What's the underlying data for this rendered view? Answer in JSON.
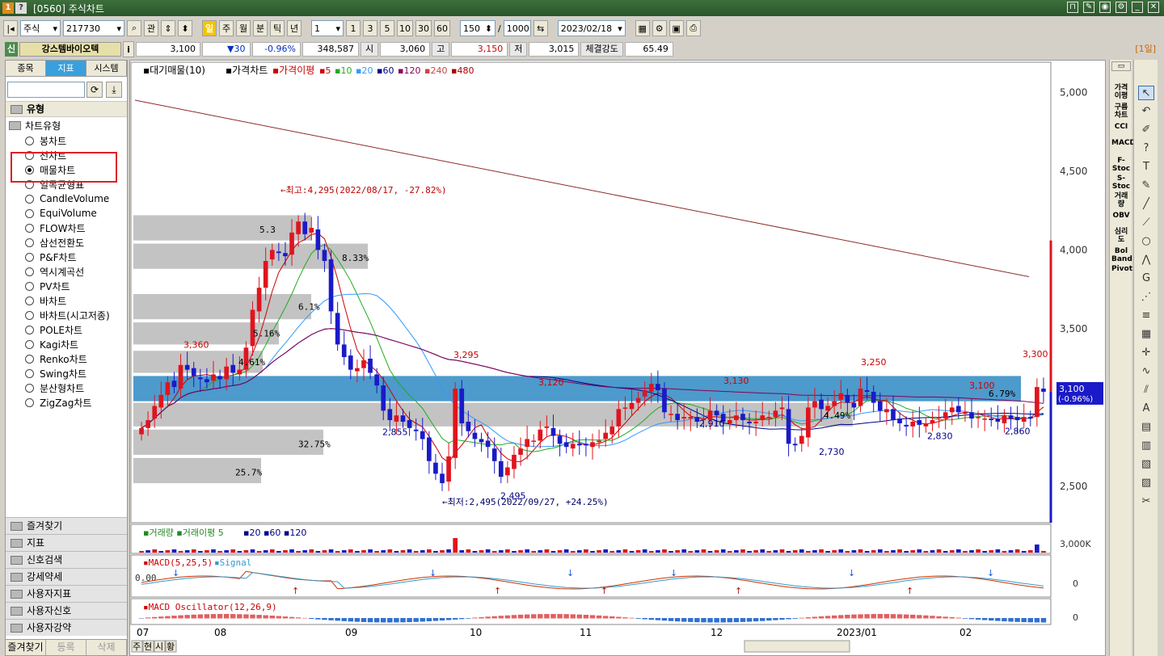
{
  "window": {
    "title": "[0560] 주식차트",
    "icon_names": [
      "app-icon",
      "help-icon"
    ],
    "controls": [
      "pin-icon",
      "note-icon",
      "camera-icon",
      "settings-icon",
      "minimize-icon",
      "close-icon"
    ]
  },
  "toolbar": {
    "market_select": "주식",
    "code": "217730",
    "mode_label": "관",
    "periods": [
      "일",
      "주",
      "월",
      "분",
      "틱",
      "년"
    ],
    "active_period": "일",
    "interval_value": "1",
    "quick_intervals": [
      "1",
      "3",
      "5",
      "10",
      "30",
      "60"
    ],
    "display_count": "150",
    "divider": "/",
    "total_count": "1000",
    "date": "2023/02/18"
  },
  "quote": {
    "tag": "신",
    "name": "강스템바이오텍",
    "info_icon": "i",
    "price": "3,100",
    "change": "▼30",
    "change_pct": "-0.96%",
    "volume": "348,587",
    "open_label": "시",
    "open": "3,060",
    "high_label": "고",
    "high": "3,150",
    "low_label": "저",
    "low": "3,015",
    "strength_label": "체결강도",
    "strength": "65.49",
    "period_badge": "[1일]"
  },
  "left_panel": {
    "tabs": [
      "종목",
      "지표",
      "시스템"
    ],
    "active_tab": "지표",
    "section_title": "유형",
    "tree_root": "차트유형",
    "chart_types": [
      "봉차트",
      "선차트",
      "매물차트",
      "일목균형표",
      "CandleVolume",
      "EquiVolume",
      "FLOW차트",
      "삼선전환도",
      "P&F차트",
      "역시계곡선",
      "PV차트",
      "바차트",
      "바차트(시고저종)",
      "POLE차트",
      "Kagi차트",
      "Renko차트",
      "Swing차트",
      "분산형차트",
      "ZigZag차트"
    ],
    "selected_type": "매물차트",
    "bottom_sections": [
      "즐겨찾기",
      "지표",
      "신호검색",
      "강세약세",
      "사용자지표",
      "사용자신호",
      "사용자강약"
    ],
    "footer": [
      "즐겨찾기",
      "등록",
      "삭제"
    ]
  },
  "chart": {
    "legend_main": {
      "vp": "대기매물(10)",
      "price": "가격차트",
      "ma": "가격이평",
      "periods": [
        "5",
        "10",
        "20",
        "60",
        "120",
        "240",
        "480"
      ],
      "colors": [
        "#cc0000",
        "#22aa22",
        "#3399ff",
        "#000088",
        "#880055",
        "#cc4444",
        "#aa0000"
      ]
    },
    "y_axis": [
      "5,000",
      "4,500",
      "4,000",
      "3,500",
      "2,500"
    ],
    "price_tag": "3,100",
    "price_tag_pct": "(-0.96%)",
    "annotations": {
      "high_note": "←최고:4,295(2022/08/17, -27.82%)",
      "low_note": "←최저:2,495(2022/09/27, +24.25%)",
      "peaks": [
        "3,360",
        "3,295",
        "3,120",
        "3,130",
        "3,250",
        "3,100",
        "3,300"
      ],
      "troughs": [
        "2,855",
        "2,495",
        "2,910",
        "2,730",
        "2,830",
        "2,860"
      ],
      "vp_pcts": [
        "5.3",
        "8.33%",
        "6.1%",
        "5.16%",
        "4.61%",
        "6.79%",
        "4.49%",
        "32.75%",
        "25.7%"
      ]
    },
    "volume_legend": {
      "vol": "거래량",
      "ma": "거래이평",
      "periods": [
        "5",
        "20",
        "60",
        "120"
      ]
    },
    "volume_axis": "3,000K",
    "macd_legend": {
      "macd": "MACD(5,25,5)",
      "signal": "Signal"
    },
    "macd_zero": "0.00",
    "macd_axis": "0",
    "osc_legend": "MACD Oscillator(12,26,9)",
    "osc_axis": "0",
    "x_labels": [
      "07",
      "08",
      "09",
      "10",
      "11",
      "12",
      "2023/01",
      "02"
    ],
    "bottom_tabs": [
      "주",
      "현",
      "시",
      "황"
    ]
  },
  "right_indicators": [
    "가격이평",
    "구름차트",
    "CCI",
    "MACD",
    "F-Stoc",
    "S-Stoc",
    "거래량",
    "OBV",
    "심리도",
    "Bol Band",
    "Pivot"
  ],
  "right_tools": [
    "cursor-icon",
    "undo-icon",
    "eraser-icon",
    "help-icon",
    "text-icon",
    "brush-icon",
    "line-icon",
    "ray-icon",
    "circle-icon",
    "zigzag-icon",
    "g-icon",
    "fan-icon",
    "fib-icon",
    "grid-icon",
    "cross-icon",
    "wave-icon",
    "channel-icon",
    "auto-icon",
    "window-icon",
    "doc-icon",
    "stats-icon",
    "code-icon",
    "wrench-icon"
  ],
  "chart_data": {
    "type": "candlestick",
    "title": "",
    "x_months": [
      "07",
      "08",
      "09",
      "10",
      "11",
      "12",
      "2023/01",
      "02"
    ],
    "ylim": [
      2300,
      5150
    ],
    "high": 4295,
    "low": 2495,
    "last": 3100,
    "closes": [
      2870,
      2920,
      3010,
      3080,
      3160,
      3130,
      3270,
      3240,
      3200,
      3180,
      3160,
      3210,
      3180,
      3260,
      3220,
      3240,
      3380,
      3620,
      3760,
      3930,
      4000,
      3980,
      3960,
      4110,
      4180,
      4100,
      4140,
      4000,
      3930,
      3610,
      3400,
      3320,
      3240,
      3250,
      3300,
      3220,
      3140,
      2980,
      2920,
      2950,
      2910,
      2870,
      2850,
      2800,
      2660,
      2580,
      2520,
      2690,
      3120,
      2900,
      2850,
      2800,
      2780,
      2750,
      2660,
      2560,
      2620,
      2700,
      2740,
      2800,
      2790,
      2860,
      2880,
      2820,
      2770,
      2750,
      2770,
      2760,
      2760,
      2780,
      2790,
      2840,
      2880,
      2990,
      3000,
      3030,
      3060,
      3110,
      3150,
      3110,
      2970,
      2960,
      2920,
      2940,
      2940,
      2910,
      2930,
      2980,
      2950,
      2910,
      2920,
      2950,
      2920,
      2900,
      2910,
      2950,
      2940,
      2980,
      3000,
      2770,
      2760,
      2820,
      3000,
      3040,
      2990,
      3010,
      3040,
      3090,
      3030,
      3000,
      3120,
      3100,
      3030,
      2980,
      2990,
      2920,
      2900,
      2880,
      2910,
      2890,
      2900,
      2920,
      2940,
      2970,
      3000,
      2970,
      2970,
      2930,
      2940,
      2930,
      2920,
      2910,
      2950,
      2930,
      2920,
      2940,
      2930,
      3130,
      3100
    ]
  }
}
